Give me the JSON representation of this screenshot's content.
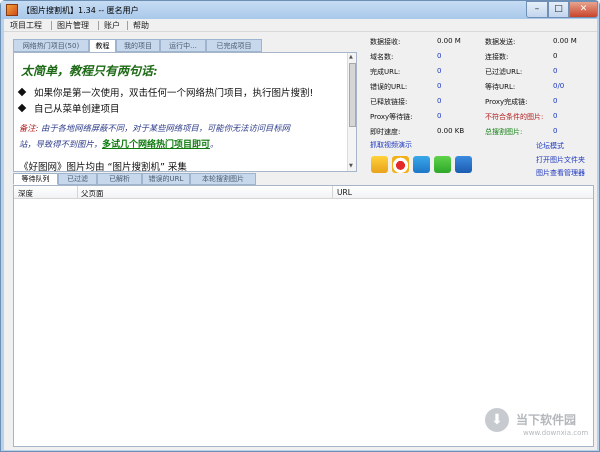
{
  "window": {
    "title": "【图片搜割机】1.34 -- 匿名用户",
    "controls": {
      "minimize": "–",
      "maximize": "□",
      "close": "✕"
    }
  },
  "menu": [
    "项目工程",
    "图片管理",
    "账户",
    "帮助"
  ],
  "top_tabs": [
    "网络热门项目(50)",
    "教程",
    "我的项目",
    "运行中...",
    "已完成项目"
  ],
  "tutorial": {
    "title": "太简单，教程只有两句话:",
    "bullets": [
      "如果你是第一次使用，双击任何一个网络热门项目，执行图片搜割!",
      "自己从菜单创建项目"
    ],
    "note_label": "备注:",
    "note_line1": "由于各地网络屏蔽不同，对于某些网络项目，可能你无法访问目标网",
    "note_line2": "站，导致得不到图片，",
    "note_link": "多试几个网络热门项目即可",
    "note_end": "。",
    "footer": "《好图网》图片均由 “图片搜割机” 采集"
  },
  "stats": {
    "left": [
      {
        "label": "数据接收:",
        "value": "0.00 M"
      },
      {
        "label": "域名数:",
        "value": "0"
      },
      {
        "label": "完成URL:",
        "value": "0"
      },
      {
        "label": "错误的URL:",
        "value": "0"
      },
      {
        "label": "已释放链接:",
        "value": "0"
      },
      {
        "label": "Proxy等待链:",
        "value": "0"
      },
      {
        "label": "即时速度:",
        "value": "0.00 KB"
      }
    ],
    "right": [
      {
        "label": "数据发送:",
        "value": "0.00 M"
      },
      {
        "label": "连接数:",
        "value": "0"
      },
      {
        "label": "已过滤URL:",
        "value": "0"
      },
      {
        "label": "等待URL:",
        "value": "0/0"
      },
      {
        "label": "Proxy完成链:",
        "value": "0"
      },
      {
        "label": "不符合条件的图片:",
        "value": "0"
      },
      {
        "label": "总搜割图片:",
        "value": "0"
      }
    ],
    "links": {
      "video": "抓取视频演示",
      "forum": "论坛模式",
      "open_folder": "打开图片文件夹",
      "viewer": "图片查看管理器"
    },
    "share_icons": [
      "qzone-icon",
      "weibo-icon",
      "qq-icon",
      "wechat-icon",
      "tencent-weibo-icon"
    ]
  },
  "bottom_tabs": [
    "等待队列",
    "已过滤",
    "已解析",
    "错误的URL",
    "本轮搜割图片"
  ],
  "grid": {
    "columns": [
      "深度",
      "父页面",
      "URL"
    ]
  },
  "watermark": {
    "main": "当下软件园",
    "sub": "www.downxia.com"
  },
  "colors": {
    "frame": "#b9d1ea",
    "title_green": "#1e6a16",
    "link_blue": "#1a35c0",
    "warn_red": "#b01a1a"
  }
}
